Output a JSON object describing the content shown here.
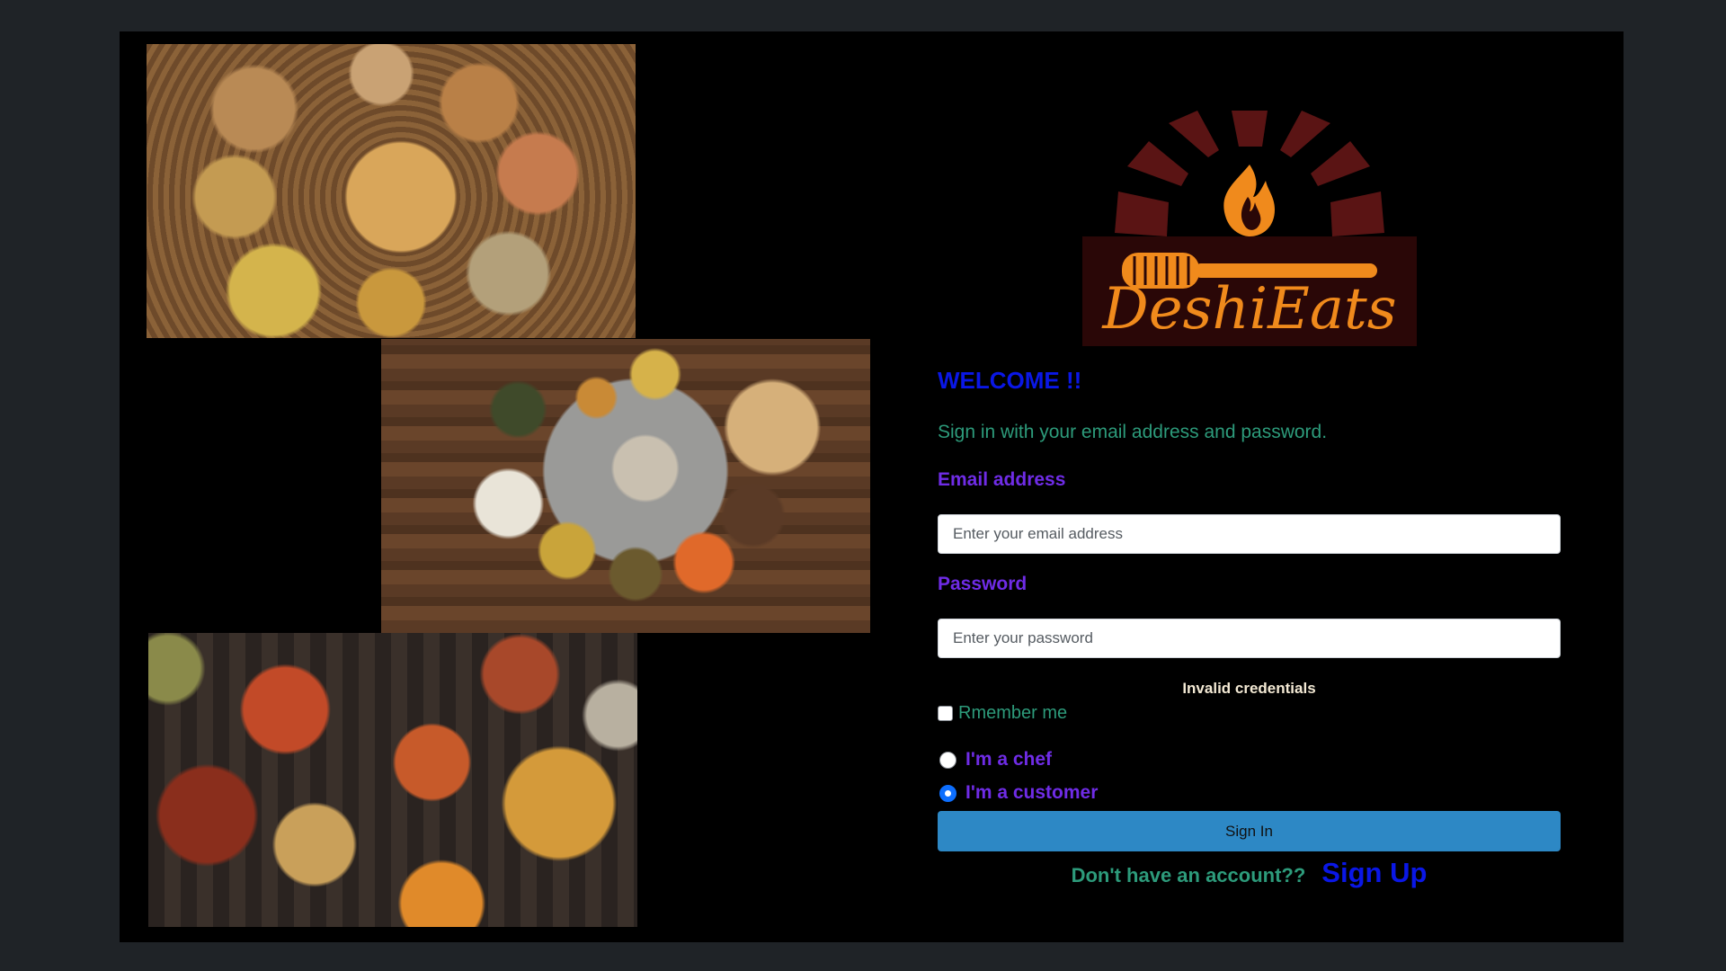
{
  "brand": {
    "logo_text": "DeshiEats"
  },
  "images": [
    {
      "name": "thali-on-wicker-plate"
    },
    {
      "name": "thali-on-wood-table"
    },
    {
      "name": "curries-spread"
    }
  ],
  "form": {
    "welcome": "WELCOME !!",
    "subtitle": "Sign in with your email address and password.",
    "email_label": "Email address",
    "email_placeholder": "Enter your email address",
    "email_value": "",
    "password_label": "Password",
    "password_placeholder": "Enter your password",
    "password_value": "",
    "error_message": "Invalid credentials",
    "remember_label": "Rmember me",
    "remember_checked": false,
    "role_options": [
      {
        "label": "I'm a chef",
        "checked": false
      },
      {
        "label": "I'm a customer",
        "checked": true
      }
    ],
    "signin_label": "Sign In",
    "signup_prompt": "Don't have an account??",
    "signup_link": "Sign Up"
  },
  "colors": {
    "page_background": "#1f2327",
    "panel_background": "#000000",
    "heading_blue": "#0a17e6",
    "label_purple": "#6f2ce6",
    "text_teal": "#2d9b7b",
    "button_blue": "#2d88c5",
    "logo_orange": "#f08a1c",
    "logo_maroon": "#5a1212"
  }
}
